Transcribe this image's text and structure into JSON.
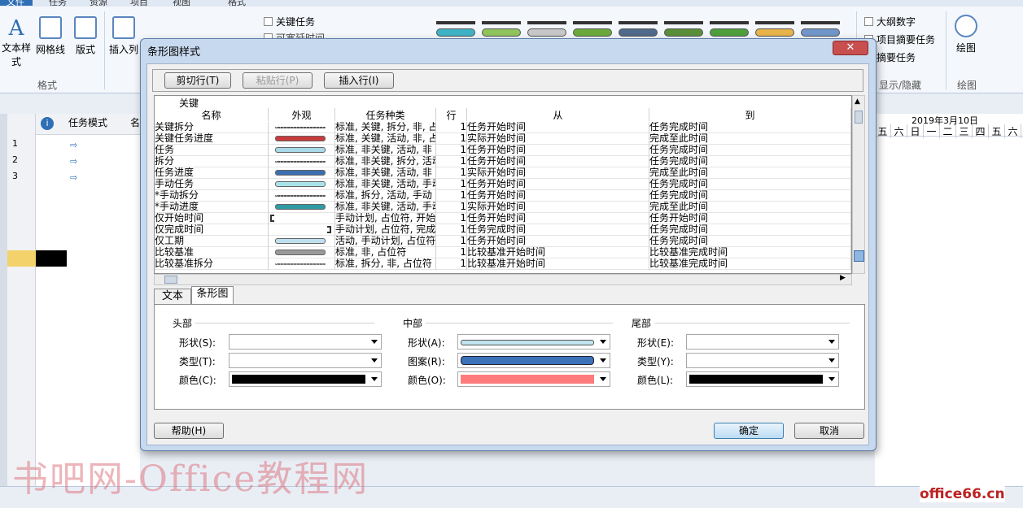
{
  "ribbon": {
    "tabs": [
      "文件",
      "任务",
      "资源",
      "项目",
      "视图",
      "格式"
    ],
    "text_style_label": "文本样式",
    "gridlines_label": "网格线",
    "layout_label": "版式",
    "group_format": "格式",
    "insert_col_label": "插入列",
    "critical_tasks": "关键任务",
    "slack_label": "可宽延时间",
    "outline_number": "大纲数字",
    "project_summary": "项目摘要任务",
    "summary_tasks": "摘要任务",
    "show_hide": "显示/隐藏",
    "drawing": "绘图",
    "drawing_group": "绘图",
    "bar_colors": [
      "#3fb3c6",
      "#8fc35c",
      "#c7c7c7",
      "#6aaa3a",
      "#4f6a8a",
      "#5a8f3a",
      "#4e9f3c",
      "#e7b34a",
      "#6f95c9"
    ]
  },
  "gantt": {
    "mode_header": "任务模式",
    "name_header": "名",
    "row_numbers": [
      "1",
      "2",
      "3"
    ],
    "date_header": "2019年3月10日",
    "days": [
      "五",
      "六",
      "日",
      "一",
      "二",
      "三",
      "四",
      "五",
      "六"
    ],
    "date_header_bottom": "2019"
  },
  "dialog": {
    "title": "条形图样式",
    "close": "✕",
    "buttons": {
      "cut": "剪切行(T)",
      "paste": "粘贴行(P)",
      "insert": "插入行(I)"
    },
    "table": {
      "group_header": "关键",
      "headers": [
        "名称",
        "外观",
        "任务种类",
        "行",
        "从",
        "到"
      ],
      "rows": [
        {
          "name": "关键拆分",
          "kind": "标准, 关键, 拆分, 非, 占",
          "row": "1",
          "from": "任务开始时间",
          "to": "任务完成时间",
          "style": "dots",
          "color": "#555555"
        },
        {
          "name": "关键任务进度",
          "kind": "标准, 关键, 活动, 非, 占",
          "row": "1",
          "from": "实际开始时间",
          "to": "完成至此时间",
          "style": "bar",
          "color": "#c93b3b"
        },
        {
          "name": "任务",
          "kind": "标准, 非关键, 活动, 非",
          "row": "1",
          "from": "任务开始时间",
          "to": "任务完成时间",
          "style": "bar",
          "color": "#a9d8e8"
        },
        {
          "name": "拆分",
          "kind": "标准, 非关键, 拆分, 活动",
          "row": "1",
          "from": "任务开始时间",
          "to": "任务完成时间",
          "style": "dots",
          "color": "#555555"
        },
        {
          "name": "任务进度",
          "kind": "标准, 非关键, 活动, 非",
          "row": "1",
          "from": "实际开始时间",
          "to": "完成至此时间",
          "style": "bar",
          "color": "#3d6fb0"
        },
        {
          "name": "手动任务",
          "kind": "标准, 非关键, 活动, 手动",
          "row": "1",
          "from": "任务开始时间",
          "to": "任务完成时间",
          "style": "bar",
          "color": "#a9e3ea"
        },
        {
          "name": "*手动拆分",
          "kind": "标准, 拆分, 活动, 手动",
          "row": "1",
          "from": "任务开始时间",
          "to": "任务完成时间",
          "style": "dots",
          "color": "#555555"
        },
        {
          "name": "*手动进度",
          "kind": "标准, 非关键, 活动, 手动",
          "row": "1",
          "from": "实际开始时间",
          "to": "完成至此时间",
          "style": "bar",
          "color": "#2e9ba5"
        },
        {
          "name": "仅开始时间",
          "kind": "手动计划, 占位符, 开始",
          "row": "1",
          "from": "任务开始时间",
          "to": "任务开始时间",
          "style": "start",
          "color": "#333333"
        },
        {
          "name": "仅完成时间",
          "kind": "手动计划, 占位符, 完成",
          "row": "1",
          "from": "任务完成时间",
          "to": "任务完成时间",
          "style": "end",
          "color": "#333333"
        },
        {
          "name": "仅工期",
          "kind": "活动, 手动计划, 占位符",
          "row": "1",
          "from": "任务开始时间",
          "to": "任务完成时间",
          "style": "bar",
          "color": "#bfe0ee"
        },
        {
          "name": "比较基准",
          "kind": "标准, 非, 占位符",
          "row": "1",
          "from": "比较基准开始时间",
          "to": "比较基准完成时间",
          "style": "bar",
          "color": "#9a9a9a"
        },
        {
          "name": "比较基准拆分",
          "kind": "标准, 拆分, 非, 占位符",
          "row": "1",
          "from": "比较基准开始时间",
          "to": "比较基准完成时间",
          "style": "dots",
          "color": "#777777"
        }
      ]
    },
    "tabs": {
      "text": "文本",
      "bars": "条形图"
    },
    "sections": {
      "head": {
        "title": "头部",
        "shape": "形状(S):",
        "type": "类型(T):",
        "color": "颜色(C):",
        "color_value": "#000000"
      },
      "middle": {
        "title": "中部",
        "shape": "形状(A):",
        "pattern": "图案(R):",
        "color": "颜色(O):",
        "shape_color": "#bfe3ef",
        "pattern_color": "#3d72b8",
        "color_value": "#ff7b7b"
      },
      "tail": {
        "title": "尾部",
        "shape": "形状(E):",
        "type": "类型(Y):",
        "color": "颜色(L):",
        "color_value": "#000000"
      }
    },
    "help": "帮助(H)",
    "ok": "确定",
    "cancel": "取消"
  },
  "watermark": "书吧网-Office教程网",
  "watermark2": "office66.cn"
}
